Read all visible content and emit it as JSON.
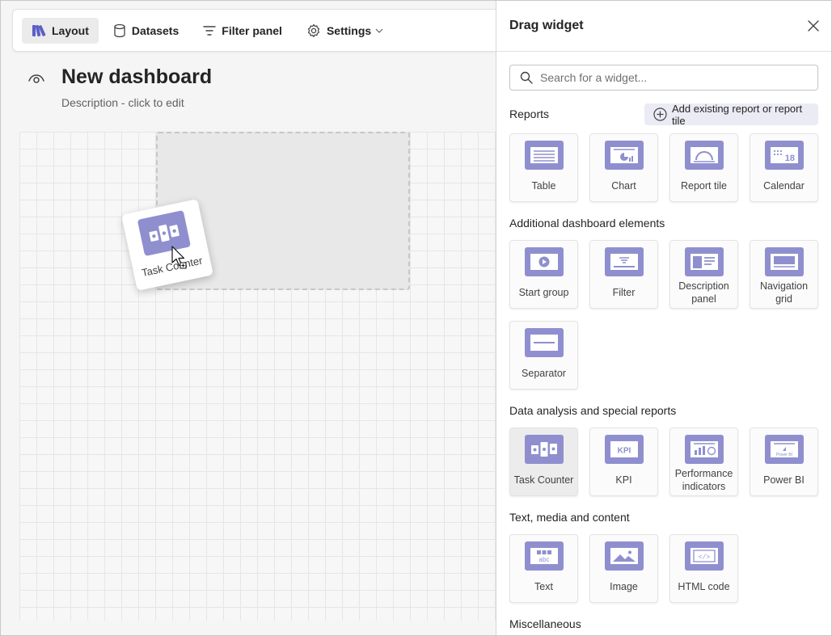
{
  "toolbar": {
    "items": [
      {
        "label": "Layout",
        "icon": "layout-icon",
        "active": true
      },
      {
        "label": "Datasets",
        "icon": "database-icon"
      },
      {
        "label": "Filter panel",
        "icon": "filter-icon"
      },
      {
        "label": "Settings",
        "icon": "gear-icon"
      }
    ]
  },
  "dashboard": {
    "title": "New dashboard",
    "description": "Description - click to edit"
  },
  "dragging": {
    "label": "Task Counter"
  },
  "panel": {
    "title": "Drag widget",
    "search_placeholder": "Search for a widget...",
    "add_existing_label": "Add existing report or report tile",
    "sections": {
      "reports": "Reports",
      "additional": "Additional dashboard elements",
      "data_analysis": "Data analysis and special reports",
      "text_media": "Text, media and content",
      "misc": "Miscellaneous"
    },
    "widgets": {
      "table": "Table",
      "chart": "Chart",
      "report_tile": "Report tile",
      "calendar": "Calendar",
      "start_group": "Start group",
      "filter": "Filter",
      "description_panel": "Description panel",
      "navigation_grid": "Navigation grid",
      "separator": "Separator",
      "task_counter": "Task Counter",
      "kpi": "KPI",
      "performance_indicators": "Performance indicators",
      "power_bi": "Power BI",
      "text": "Text",
      "image": "Image",
      "html_code": "HTML code"
    },
    "icon_glyphs": {
      "kpi": "KPI",
      "calendar_day": "18",
      "text_abc": "abc",
      "power_bi": "Power BI",
      "html_code": "</>"
    }
  },
  "colors": {
    "accent": "#5b5fc7",
    "icon_fill": "#8f8fcf"
  }
}
